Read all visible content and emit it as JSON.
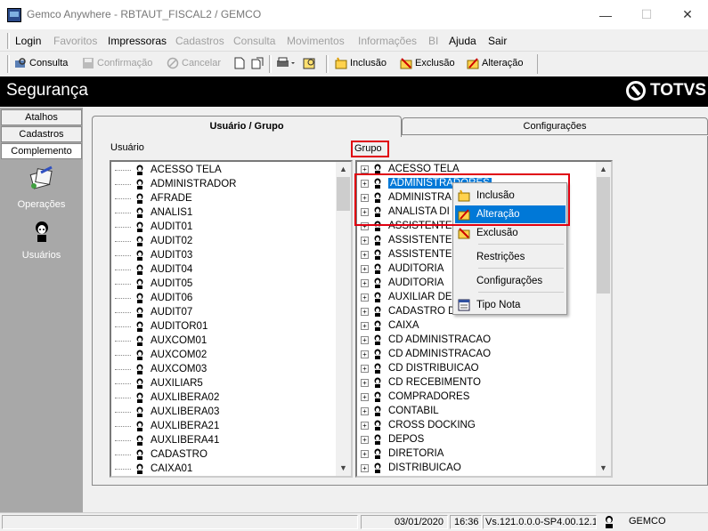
{
  "window": {
    "title": "Gemco Anywhere - RBTAUT_FISCAL2 / GEMCO"
  },
  "menu": [
    "Login",
    "Favoritos",
    "Impressoras",
    "Cadastros",
    "Consulta",
    "Movimentos",
    "Informações",
    "BI",
    "Ajuda",
    "Sair"
  ],
  "toolbar": {
    "consulta": "Consulta",
    "confirmacao": "Confirmação",
    "cancelar": "Cancelar",
    "inclusao": "Inclusão",
    "exclusao": "Exclusão",
    "alteracao": "Alteração"
  },
  "header": {
    "title": "Segurança",
    "brand": "TOTVS"
  },
  "sidebar": {
    "tabs": [
      "Atalhos",
      "Cadastros",
      "Complemento"
    ],
    "items": [
      "Operações",
      "Usuários"
    ]
  },
  "tabs": {
    "user_group": "Usuário  / Grupo",
    "config": "Configurações"
  },
  "labels": {
    "usuario": "Usuário",
    "grupo": "Grupo"
  },
  "users": [
    "ACESSO TELA",
    "ADMINISTRADOR",
    "AFRADE",
    "ANALIS1",
    "AUDIT01",
    "AUDIT02",
    "AUDIT03",
    "AUDIT04",
    "AUDIT05",
    "AUDIT06",
    "AUDIT07",
    "AUDITOR01",
    "AUXCOM01",
    "AUXCOM02",
    "AUXCOM03",
    "AUXILIAR5",
    "AUXLIBERA02",
    "AUXLIBERA03",
    "AUXLIBERA21",
    "AUXLIBERA41",
    "CADASTRO",
    "CAIXA01"
  ],
  "groups": [
    "ACESSO TELA",
    "ADMINISTRADORES",
    "ADMINISTRA",
    "ANALISTA DI",
    "ASSISTENTE",
    "ASSISTENTE",
    "ASSISTENTE",
    "AUDITORIA",
    "AUDITORIA",
    "AUXILIAR DE",
    "CADASTRO D",
    "CAIXA",
    "CD ADMINISTRACAO",
    "CD ADMINISTRACAO",
    "CD DISTRIBUICAO",
    "CD RECEBIMENTO",
    "COMPRADORES",
    "CONTABIL",
    "CROSS DOCKING",
    "DEPOS",
    "DIRETORIA",
    "DISTRIBUICAO"
  ],
  "context_menu": {
    "inclusao": "Inclusão",
    "alteracao": "Alteração",
    "exclusao": "Exclusão",
    "restricoes": "Restrições",
    "configuracoes": "Configurações",
    "tipo_nota": "Tipo Nota"
  },
  "status": {
    "date": "03/01/2020",
    "time": "16:36",
    "version": "Vs.121.0.0.0-SP4.00.12.1",
    "user": "GEMCO"
  }
}
